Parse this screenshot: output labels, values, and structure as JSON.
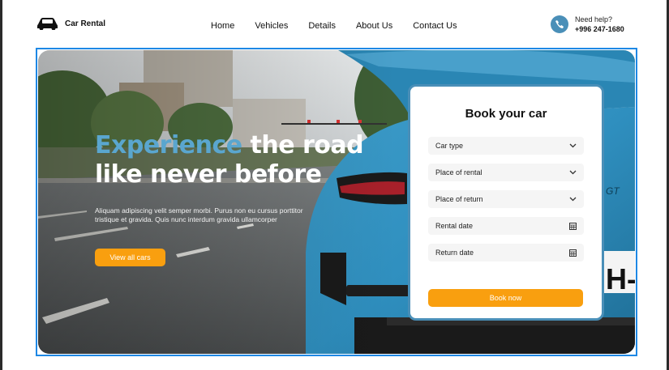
{
  "header": {
    "brand": "Car Rental",
    "nav": [
      "Home",
      "Vehicles",
      "Details",
      "About Us",
      "Contact Us"
    ],
    "help_label": "Need help?",
    "help_phone": "+996 247-1680"
  },
  "hero": {
    "headline_accent": "Experience",
    "headline_rest": " the road like never before",
    "description": "Aliquam adipiscing velit semper morbi. Purus non eu cursus porttitor tristique et gravida. Quis nunc interdum gravida ullamcorper",
    "cta": "View all cars",
    "plate_text": "H-"
  },
  "booking": {
    "title": "Book your car",
    "fields": [
      {
        "label": "Car type",
        "icon": "chevron-down-icon"
      },
      {
        "label": "Place of rental",
        "icon": "chevron-down-icon"
      },
      {
        "label": "Place of return",
        "icon": "chevron-down-icon"
      },
      {
        "label": "Rental date",
        "icon": "calendar-icon"
      },
      {
        "label": "Return date",
        "icon": "calendar-icon"
      }
    ],
    "submit": "Book now"
  },
  "colors": {
    "accent_orange": "#f99f0f",
    "accent_blue": "#4a8fb8",
    "headline_accent": "#5aa6cf",
    "selection_outline": "#1e88e5"
  }
}
